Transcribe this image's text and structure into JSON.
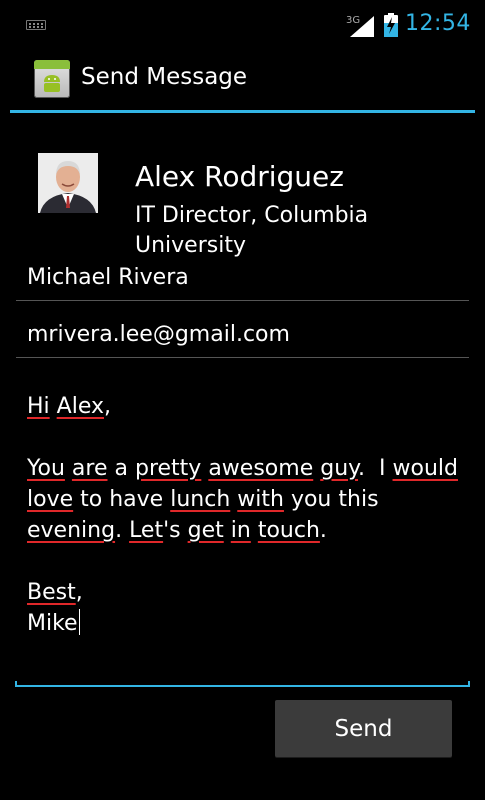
{
  "status_bar": {
    "network": "3G",
    "time": "12:54",
    "accent_color": "#33b5e5",
    "icons": [
      "keyboard-icon",
      "signal-icon",
      "battery-charging-icon"
    ]
  },
  "action_bar": {
    "title": "Send Message",
    "icon": "android-app-icon"
  },
  "contact": {
    "name": "Alex Rodriguez",
    "title": "IT Director, Columbia University"
  },
  "form": {
    "sender_name": "Michael Rivera",
    "sender_email": "mrivera.lee@gmail.com",
    "message_lines": [
      "Hi Alex,",
      "",
      "You are a pretty awesome guy.  I would love to have lunch with you this evening. Let's get in touch.",
      "",
      "Best,",
      "Mike"
    ]
  },
  "actions": {
    "send_label": "Send"
  },
  "colors": {
    "background": "#000000",
    "accent": "#33b5e5",
    "spellcheck": "#e0282a",
    "button": "#3b3b3b"
  }
}
